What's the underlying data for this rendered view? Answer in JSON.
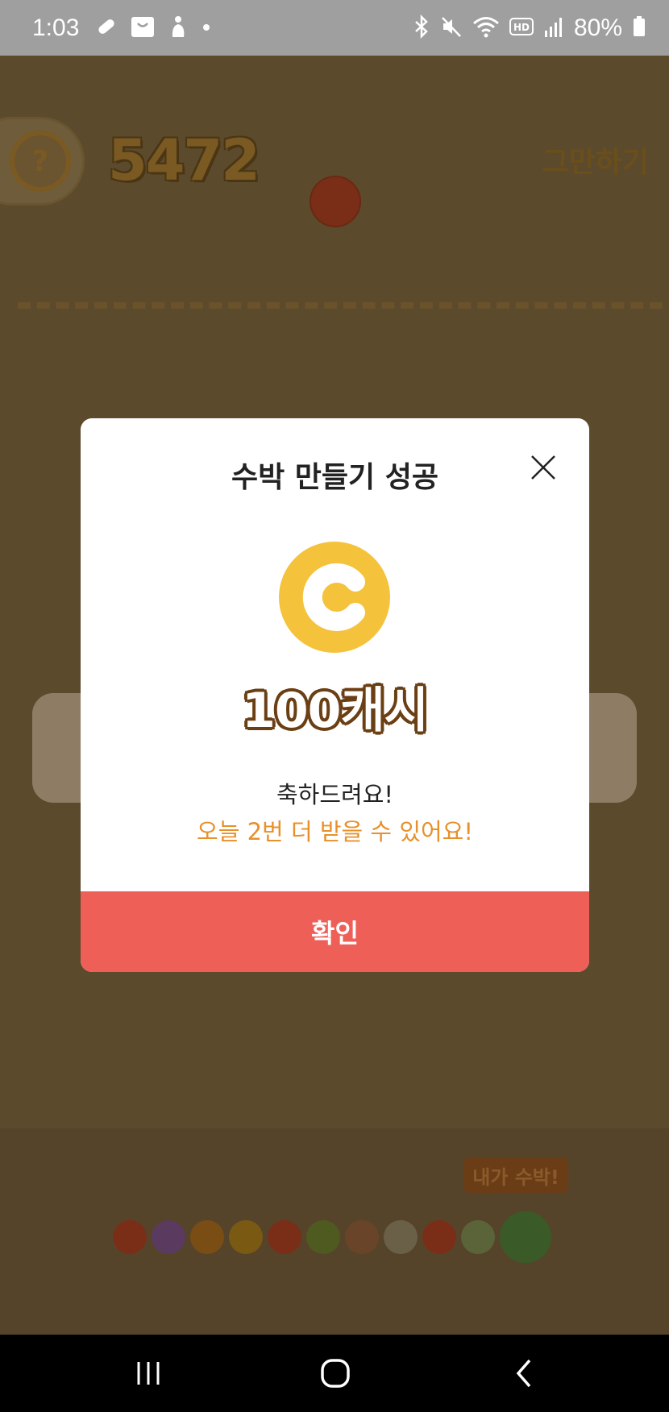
{
  "status_bar": {
    "time": "1:03",
    "battery_percent": "80%",
    "left_icons": [
      "pill-icon",
      "shopping-bag-icon",
      "person-walking-icon",
      "notification-dot-icon"
    ],
    "right_icons": [
      "bluetooth-icon",
      "mute-icon",
      "wifi-icon",
      "hd-icon",
      "signal-icon",
      "battery-icon"
    ]
  },
  "game": {
    "score": "5472",
    "help_label": "?",
    "quit_label": "그만하기",
    "tray_tag": "내가 수박!",
    "fruit_colors": [
      "#7a2e18",
      "#5a3a5e",
      "#7a4d15",
      "#7a5a12",
      "#7a2e18",
      "#4e5a20",
      "#6a4428",
      "#6a6048",
      "#7a2e18",
      "#5a6438",
      "#3a5a28"
    ]
  },
  "dialog": {
    "title": "수박 만들기 성공",
    "reward": "100캐시",
    "message_line1": "축하드려요!",
    "message_line2": "오늘 2번 더 받을 수 있어요!",
    "confirm_label": "확인",
    "coin_icon": "cash-coin-icon",
    "close_icon": "close-icon"
  },
  "colors": {
    "accent_red": "#ee5f58",
    "coin_yellow": "#f5c23c",
    "message_orange": "#e8902a",
    "overlay_brown": "#5c4a2c"
  },
  "nav_bar": {
    "icons": [
      "recent-apps-icon",
      "home-icon",
      "back-icon"
    ]
  }
}
